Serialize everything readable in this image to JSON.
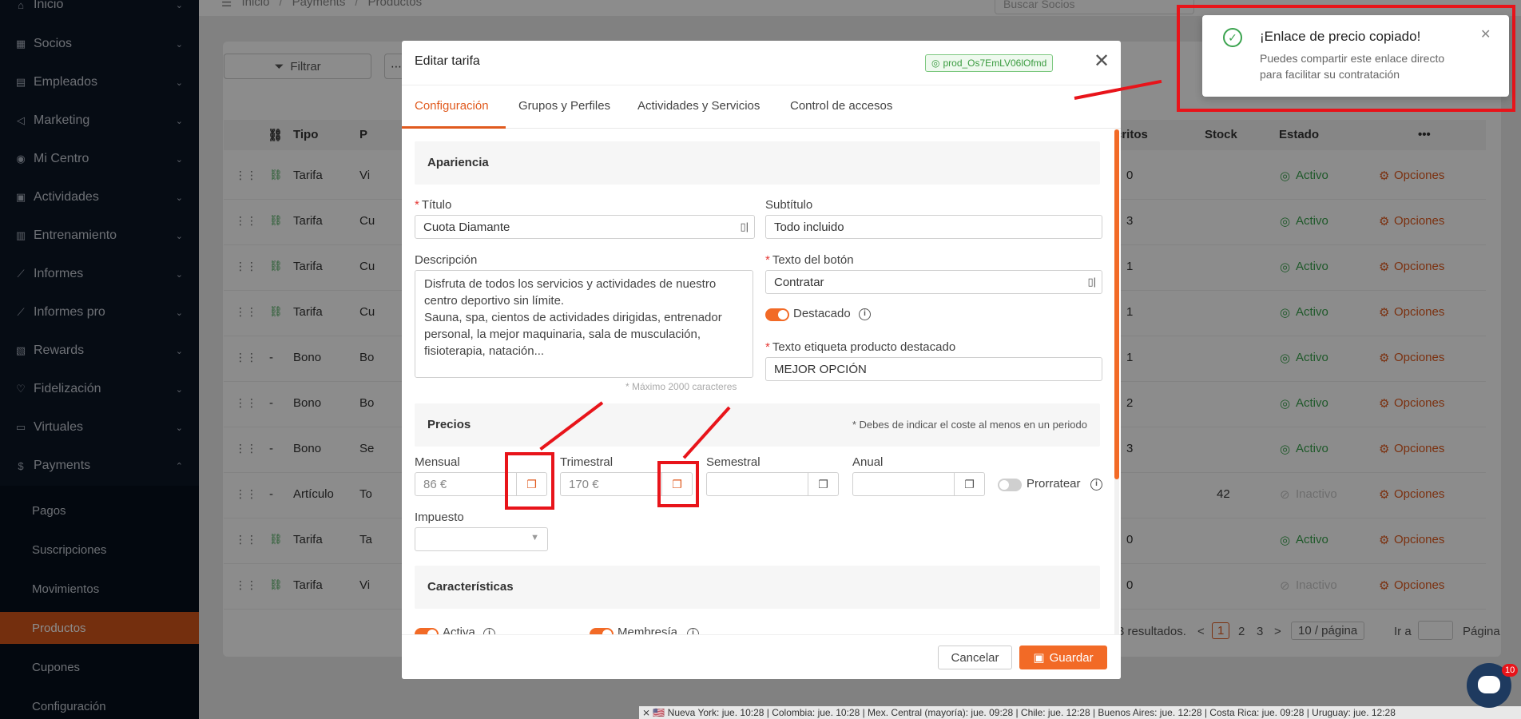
{
  "sidebar": {
    "items": [
      {
        "icon": "home-icon",
        "label": "Inicio",
        "glyph": "⌂"
      },
      {
        "icon": "bank-icon",
        "label": "Socios",
        "glyph": "▦"
      },
      {
        "icon": "id-card-icon",
        "label": "Empleados",
        "glyph": "▤"
      },
      {
        "icon": "megaphone-icon",
        "label": "Marketing",
        "glyph": "◁"
      },
      {
        "icon": "location-icon",
        "label": "Mi Centro",
        "glyph": "◉"
      },
      {
        "icon": "calendar-icon",
        "label": "Actividades",
        "glyph": "▣"
      },
      {
        "icon": "training-icon",
        "label": "Entrenamiento",
        "glyph": "▥"
      },
      {
        "icon": "chart-line-icon",
        "label": "Informes",
        "glyph": "⟋"
      },
      {
        "icon": "chart-line-pro-icon",
        "label": "Informes pro",
        "glyph": "⟋"
      },
      {
        "icon": "gift-icon",
        "label": "Rewards",
        "glyph": "▧"
      },
      {
        "icon": "heart-icon",
        "label": "Fidelización",
        "glyph": "♡"
      },
      {
        "icon": "video-icon",
        "label": "Virtuales",
        "glyph": "▭"
      },
      {
        "icon": "dollar-icon",
        "label": "Payments",
        "glyph": "$"
      }
    ],
    "sub_items": [
      "Pagos",
      "Suscripciones",
      "Movimientos",
      "Productos",
      "Cupones",
      "Configuración"
    ],
    "active_sub": "Productos"
  },
  "breadcrumb": {
    "items": [
      "Inicio",
      "Payments",
      "Productos"
    ],
    "separator": "/"
  },
  "search": {
    "placeholder": "Buscar Socios"
  },
  "toolbar": {
    "filter_label": "Filtrar"
  },
  "table": {
    "headers": {
      "tipo": "Tipo",
      "p": "P",
      "inscritos": "critos",
      "stock": "Stock",
      "estado": "Estado"
    },
    "rows": [
      {
        "tipo": "Tarifa",
        "name": "Vi",
        "linked": true,
        "inscritos": "0",
        "stock": "",
        "estado": "Activo",
        "active": true
      },
      {
        "tipo": "Tarifa",
        "name": "Cu",
        "linked": true,
        "inscritos": "3",
        "stock": "",
        "estado": "Activo",
        "active": true
      },
      {
        "tipo": "Tarifa",
        "name": "Cu",
        "linked": true,
        "inscritos": "1",
        "stock": "",
        "estado": "Activo",
        "active": true
      },
      {
        "tipo": "Tarifa",
        "name": "Cu",
        "linked": true,
        "inscritos": "1",
        "stock": "",
        "estado": "Activo",
        "active": true
      },
      {
        "tipo": "Bono",
        "name": "Bo",
        "linked": false,
        "inscritos": "1",
        "stock": "",
        "estado": "Activo",
        "active": true
      },
      {
        "tipo": "Bono",
        "name": "Bo",
        "linked": false,
        "inscritos": "2",
        "stock": "",
        "estado": "Activo",
        "active": true
      },
      {
        "tipo": "Bono",
        "name": "Se",
        "linked": false,
        "inscritos": "3",
        "stock": "",
        "estado": "Activo",
        "active": true
      },
      {
        "tipo": "Artículo",
        "name": "To",
        "linked": false,
        "inscritos": "",
        "stock": "42",
        "estado": "Inactivo",
        "active": false
      },
      {
        "tipo": "Tarifa",
        "name": "Ta",
        "linked": true,
        "inscritos": "0",
        "stock": "",
        "estado": "Activo",
        "active": true
      },
      {
        "tipo": "Tarifa",
        "name": "Vi",
        "linked": true,
        "inscritos": "0",
        "stock": "",
        "estado": "Inactivo",
        "active": false
      }
    ],
    "options_label": "Opciones",
    "dash": "-"
  },
  "pagination": {
    "results": "3 resultados.",
    "pages": [
      "1",
      "2",
      "3"
    ],
    "current": "1",
    "per_page": "10 / página",
    "goto": "Ir a",
    "page_label": "Página"
  },
  "modal": {
    "title": "Editar tarifa",
    "product_id": "prod_Os7EmLV06lOfmd",
    "tabs": [
      "Configuración",
      "Grupos y Perfiles",
      "Actividades y Servicios",
      "Control de accesos"
    ],
    "active_tab": "Configuración",
    "appearance": {
      "section_title": "Apariencia",
      "title_label": "Título",
      "title_value": "Cuota Diamante",
      "subtitle_label": "Subtítulo",
      "subtitle_value": "Todo incluido",
      "description_label": "Descripción",
      "description_value": "Disfruta de todos los servicios y actividades de nuestro centro deportivo sin límite.\nSauna, spa, cientos de actividades dirigidas, entrenador personal, la mejor maquinaria, sala de musculación, fisioterapia, natación...",
      "description_hint": "* Máximo 2000 caracteres",
      "button_text_label": "Texto del botón",
      "button_text_value": "Contratar",
      "featured_label": "Destacado",
      "featured_on": true,
      "featured_tag_label": "Texto etiqueta producto destacado",
      "featured_tag_value": "MEJOR OPCIÓN"
    },
    "prices": {
      "section_title": "Precios",
      "note": "* Debes de indicar el coste al menos en un periodo",
      "monthly_label": "Mensual",
      "monthly_value": "86 €",
      "quarterly_label": "Trimestral",
      "quarterly_value": "170 €",
      "semester_label": "Semestral",
      "semester_value": "",
      "annual_label": "Anual",
      "annual_value": "",
      "prorate_label": "Prorratear",
      "prorate_on": false,
      "tax_label": "Impuesto",
      "tax_value": ""
    },
    "features": {
      "section_title": "Características",
      "active_label": "Activa",
      "membership_label": "Membresía"
    },
    "cancel_label": "Cancelar",
    "save_label": "Guardar"
  },
  "toast": {
    "title": "¡Enlace de precio copiado!",
    "message": "Puedes compartir este enlace directo para facilitar su contratación"
  },
  "timezones": "⨯ 🇺🇸 Nueva York: jue. 10:28  |  Colombia: jue. 10:28  |  Mex. Central (mayoría): jue. 09:28  |  Chile: jue. 12:28  |  Buenos Aires: jue. 12:28  |  Costa Rica: jue. 09:28  |  Uruguay: jue. 12:28",
  "chat": {
    "badge": "10"
  },
  "colors": {
    "accent": "#f26a26",
    "success": "#3aa34e",
    "annotation": "#e8141a",
    "sidebar": "#0c1626"
  }
}
